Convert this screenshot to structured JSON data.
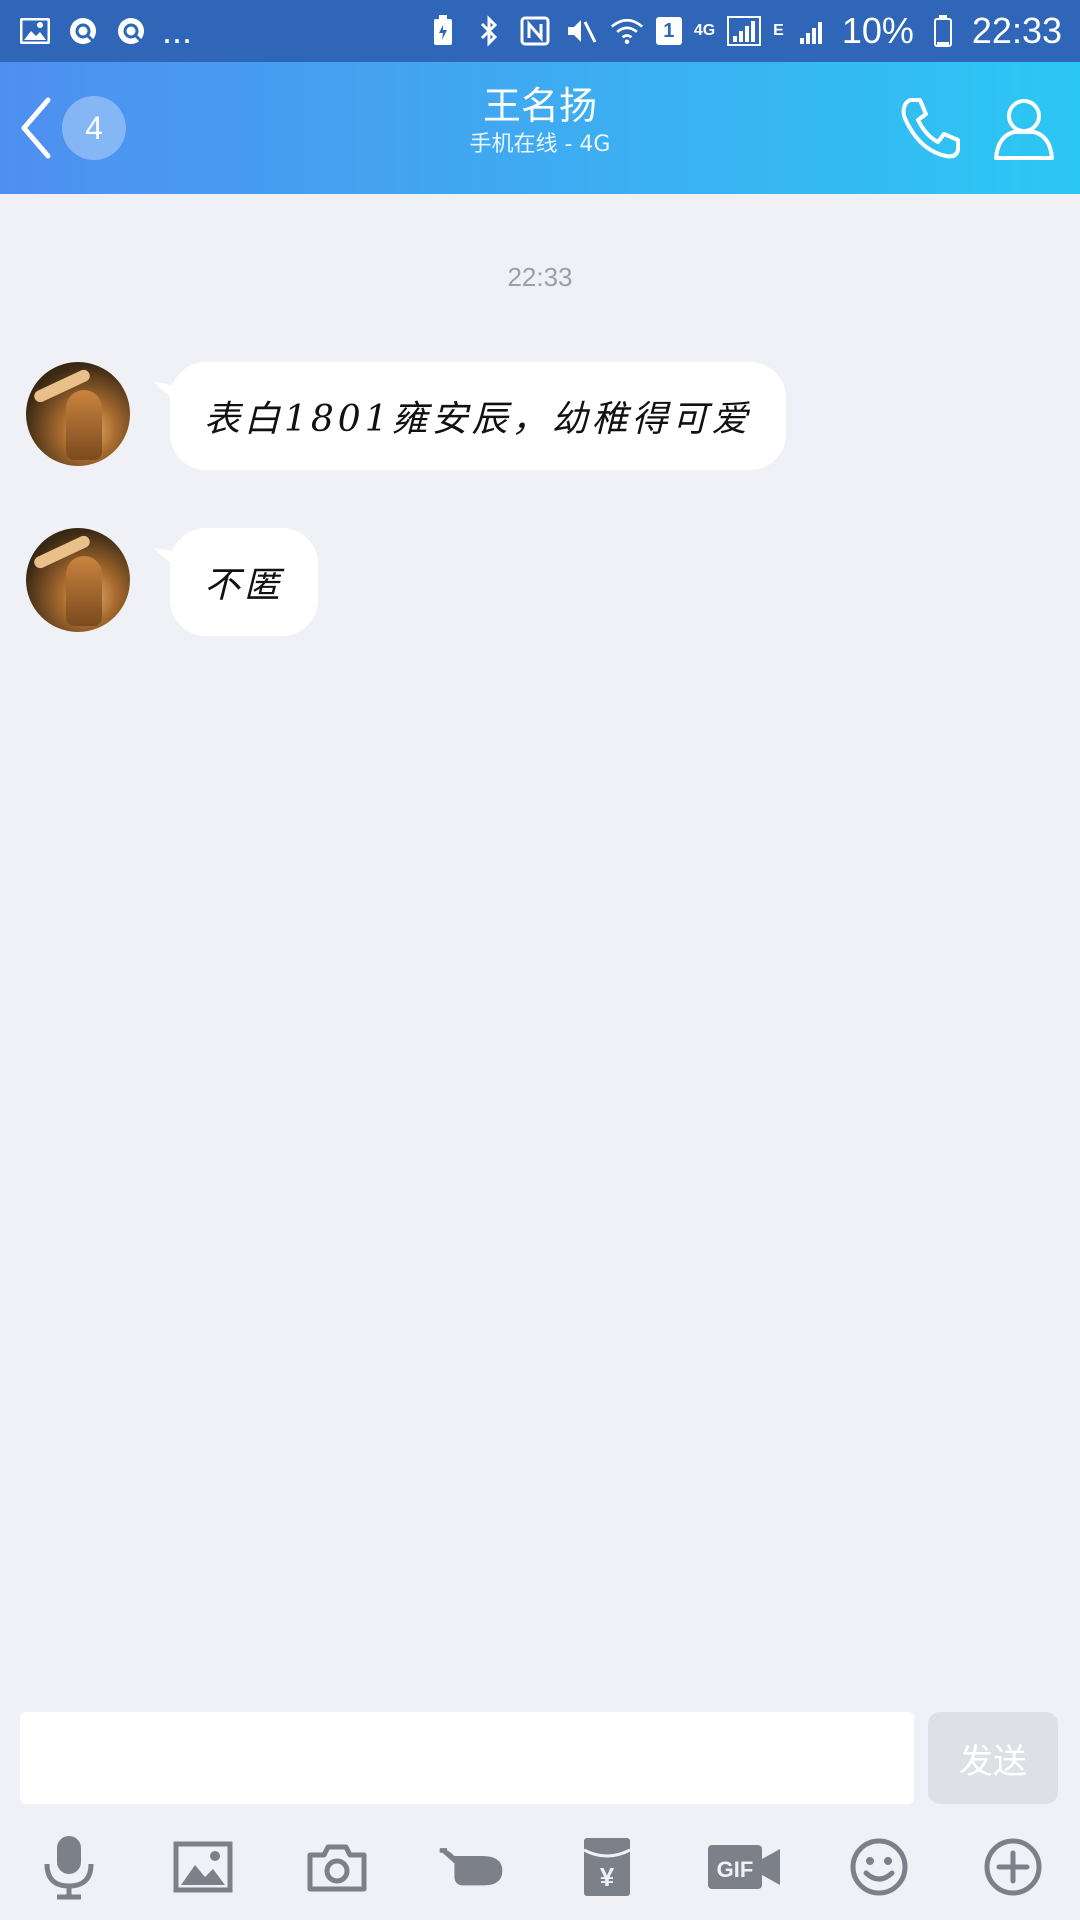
{
  "status_bar": {
    "network_label": "4G",
    "edge_label": "E",
    "sim_label": "1",
    "battery": "10%",
    "time": "22:33",
    "more_indicator": "..."
  },
  "header": {
    "unread_count": "4",
    "contact_name": "王名扬",
    "contact_status": "手机在线 - 4G",
    "icons": [
      "back-chevron",
      "phone-icon",
      "profile-icon"
    ]
  },
  "chat": {
    "time_divider": "22:33",
    "messages": [
      {
        "sender": "contact",
        "text": "表白1801雍安辰，幼稚得可爱"
      },
      {
        "sender": "contact",
        "text": "不匿"
      }
    ]
  },
  "composer": {
    "input_value": "",
    "send_label": "发送"
  },
  "toolbar": {
    "items": [
      "microphone-icon",
      "image-icon",
      "camera-icon",
      "poke-hand-icon",
      "red-packet-icon",
      "gif-icon",
      "emoji-icon",
      "plus-icon"
    ],
    "gif_label": "GIF",
    "yuan_label": "¥"
  },
  "colors": {
    "header_gradient_start": "#4f8ff0",
    "header_gradient_end": "#2bc7f4",
    "status_bar": "#2f66b8",
    "chat_background": "#eff1f6",
    "toolbar_icon": "#7c8088"
  }
}
